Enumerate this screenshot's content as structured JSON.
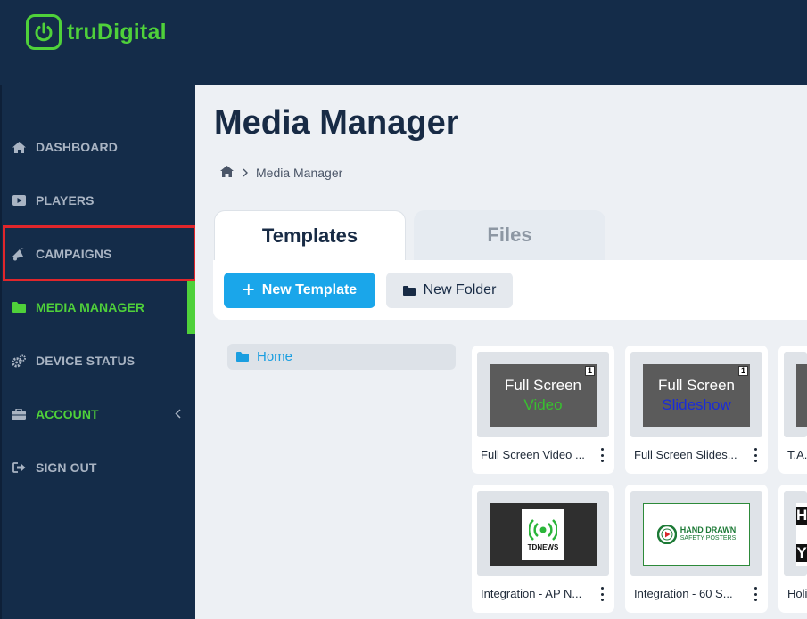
{
  "brand": {
    "name": "truDigital",
    "color": "#4fd13a"
  },
  "sidebar": {
    "items": [
      {
        "label": "DASHBOARD",
        "icon": "home-icon"
      },
      {
        "label": "PLAYERS",
        "icon": "play-icon"
      },
      {
        "label": "CAMPAIGNS",
        "icon": "megaphone-icon"
      },
      {
        "label": "MEDIA MANAGER",
        "icon": "folder-icon",
        "active": true
      },
      {
        "label": "DEVICE STATUS",
        "icon": "gears-icon"
      },
      {
        "label": "ACCOUNT",
        "icon": "briefcase-icon"
      },
      {
        "label": "SIGN OUT",
        "icon": "sign-out-icon"
      }
    ]
  },
  "main": {
    "title": "Media Manager",
    "breadcrumb": {
      "current": "Media Manager"
    },
    "tabs": [
      {
        "label": "Templates",
        "active": true
      },
      {
        "label": "Files"
      }
    ],
    "toolbar": {
      "new_template": "New Template",
      "new_folder": "New Folder"
    },
    "tree": {
      "home": "Home"
    },
    "cards": [
      {
        "caption": "Full Screen Video ...",
        "thumb_line1": "Full Screen",
        "thumb_line2": "Video",
        "badge": "1"
      },
      {
        "caption": "Full Screen Slides...",
        "thumb_line1": "Full Screen",
        "thumb_line2": "Slideshow",
        "badge": "1"
      },
      {
        "caption": "T.A."
      },
      {
        "caption": "Integration - AP N...",
        "thumb_label": "TDNEWS"
      },
      {
        "caption": "Integration - 60 S...",
        "thumb_line1": "HAND DRAWN",
        "thumb_line2": "SAFETY POSTERS"
      },
      {
        "caption": "Holi",
        "thumb_line1": "H",
        "thumb_line2": "Y"
      }
    ]
  },
  "colors": {
    "sidebar_bg": "#142c49",
    "accent_blue": "#1aa6ea",
    "highlight_red": "#e0262b",
    "active_green": "#4fd13a"
  }
}
